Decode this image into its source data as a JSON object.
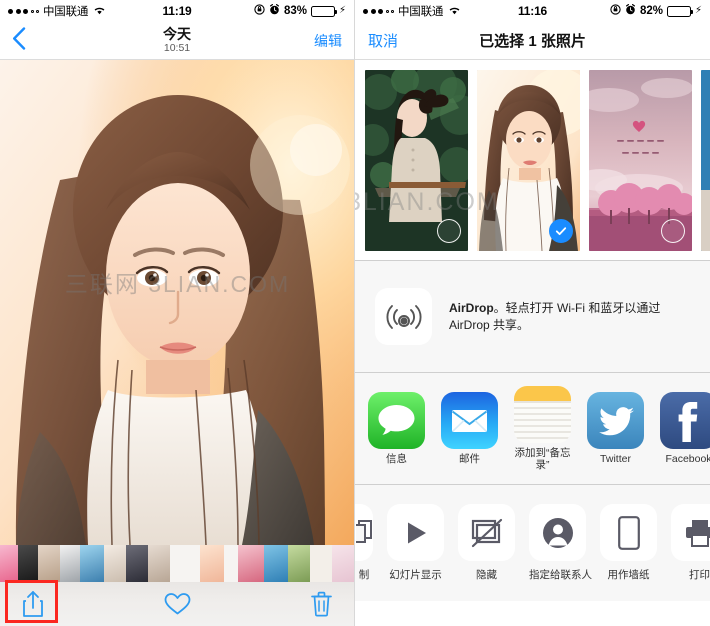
{
  "left_phone": {
    "status_bar": {
      "carrier": "中国联通",
      "wifi_icon": "wifi-icon",
      "time": "11:19",
      "rotation_lock_icon": "rotation-lock-icon",
      "alarm_icon": "alarm-clock-icon",
      "battery_percent": "83%",
      "battery_level": 83,
      "battery_color": "#4cd964",
      "charging_icon": "lightning-bolt-icon"
    },
    "nav": {
      "back_icon": "chevron-left-icon",
      "title": "今天",
      "subtitle": "10:51",
      "edit_label": "编辑"
    },
    "photo": {
      "watermark": "三联网 3LIAN.COM",
      "description": "backlit portrait of a young woman at sunset"
    },
    "toolbar": {
      "share_icon": "share-upload-icon",
      "favorite_icon": "heart-icon",
      "delete_icon": "trash-icon",
      "accent_color": "#2e9bf0"
    },
    "highlight": {
      "target": "share-upload-icon",
      "color": "#fb2720"
    },
    "filmstrip": [
      "#e8648c",
      "#2b2b2b",
      "#d8c9bd",
      "#cfd5db",
      "#5b8fb5",
      "#e3dcd6",
      "#3b3b47",
      "#d9cfc6",
      "#f0c9b8",
      "#efe1d8",
      "#e4909f",
      "#4f9fc9",
      "#9db87e",
      "#f1eae4",
      "#ecd9e2",
      "#cfe0df",
      "#e0cfc0",
      "#bfa898"
    ]
  },
  "right_phone": {
    "status_bar": {
      "carrier": "中国联通",
      "wifi_icon": "wifi-icon",
      "time": "11:16",
      "rotation_lock_icon": "rotation-lock-icon",
      "alarm_icon": "alarm-clock-icon",
      "battery_percent": "82%",
      "battery_level": 82,
      "battery_color": "#4cd964",
      "charging_icon": "lightning-bolt-icon"
    },
    "nav": {
      "cancel_label": "取消",
      "title": "已选择 1 张照片"
    },
    "selection": {
      "watermark": "3LIAN.COM",
      "selected_count": 1,
      "thumbnails": [
        {
          "name": "photo-green-foliage-portrait",
          "selected": false,
          "caption": ""
        },
        {
          "name": "photo-sunset-portrait",
          "selected": true,
          "caption": ""
        },
        {
          "name": "photo-pink-cherry-sky",
          "selected": false,
          "caption": "不必仰望别人 自己亦是风景"
        },
        {
          "name": "photo-partial-right",
          "selected": false,
          "caption": ""
        }
      ]
    },
    "airdrop": {
      "icon": "airdrop-icon",
      "text_bold": "AirDrop",
      "text_rest": "。轻点打开 Wi-Fi 和蓝牙以通过 AirDrop 共享。"
    },
    "apps": [
      {
        "label": "信息",
        "icon": "messages-icon",
        "color": "#5ad24f"
      },
      {
        "label": "邮件",
        "icon": "mail-icon",
        "color": "#1f9bf3"
      },
      {
        "label": "添加到“备忘录”",
        "icon": "notes-icon",
        "color": "#fbc02d"
      },
      {
        "label": "Twitter",
        "icon": "twitter-icon",
        "color": "#4e9fd1"
      },
      {
        "label": "Facebook",
        "icon": "facebook-icon",
        "color": "#3b5998"
      },
      {
        "label": "",
        "icon": "partial-app-icon",
        "color": "#fdd44f"
      }
    ],
    "actions": [
      {
        "label": "制",
        "icon": "copy-icon"
      },
      {
        "label": "幻灯片显示",
        "icon": "slideshow-play-icon"
      },
      {
        "label": "隐藏",
        "icon": "hide-slash-icon"
      },
      {
        "label": "指定给联系人",
        "icon": "assign-contact-icon"
      },
      {
        "label": "用作墙纸",
        "icon": "use-as-wallpaper-icon"
      },
      {
        "label": "打印",
        "icon": "printer-icon"
      }
    ],
    "highlight": {
      "target": "用作墙纸",
      "color": "#fb2720"
    }
  }
}
